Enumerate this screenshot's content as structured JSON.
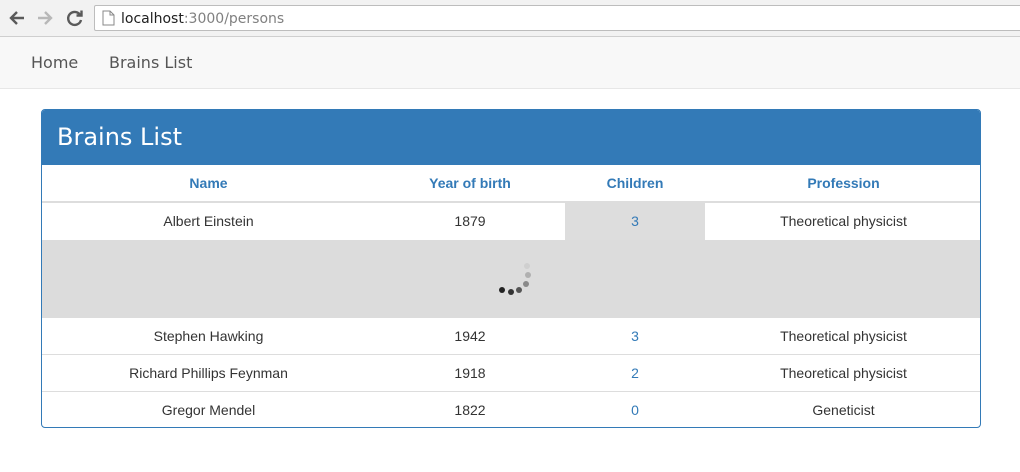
{
  "browser": {
    "url_host": "localhost",
    "url_path": ":3000/persons"
  },
  "navbar": {
    "home_label": "Home",
    "brains_label": "Brains List"
  },
  "panel": {
    "title": "Brains List",
    "headers": {
      "name": "Name",
      "year": "Year of birth",
      "children": "Children",
      "profession": "Profession"
    },
    "rows": [
      {
        "name": "Albert Einstein",
        "year": "1879",
        "children": "3",
        "profession": "Theoretical physicist"
      },
      {
        "name": "Stephen Hawking",
        "year": "1942",
        "children": "3",
        "profession": "Theoretical physicist"
      },
      {
        "name": "Richard Phillips Feynman",
        "year": "1918",
        "children": "2",
        "profession": "Theoretical physicist"
      },
      {
        "name": "Gregor Mendel",
        "year": "1822",
        "children": "0",
        "profession": "Geneticist"
      }
    ]
  },
  "icons": {
    "back": "back-arrow-icon",
    "forward": "forward-arrow-icon",
    "reload": "reload-icon",
    "page": "page-icon",
    "loading": "loading-spinner-icon"
  },
  "colors": {
    "primary": "#337ab7",
    "loading_bg": "#dcdcdc"
  }
}
